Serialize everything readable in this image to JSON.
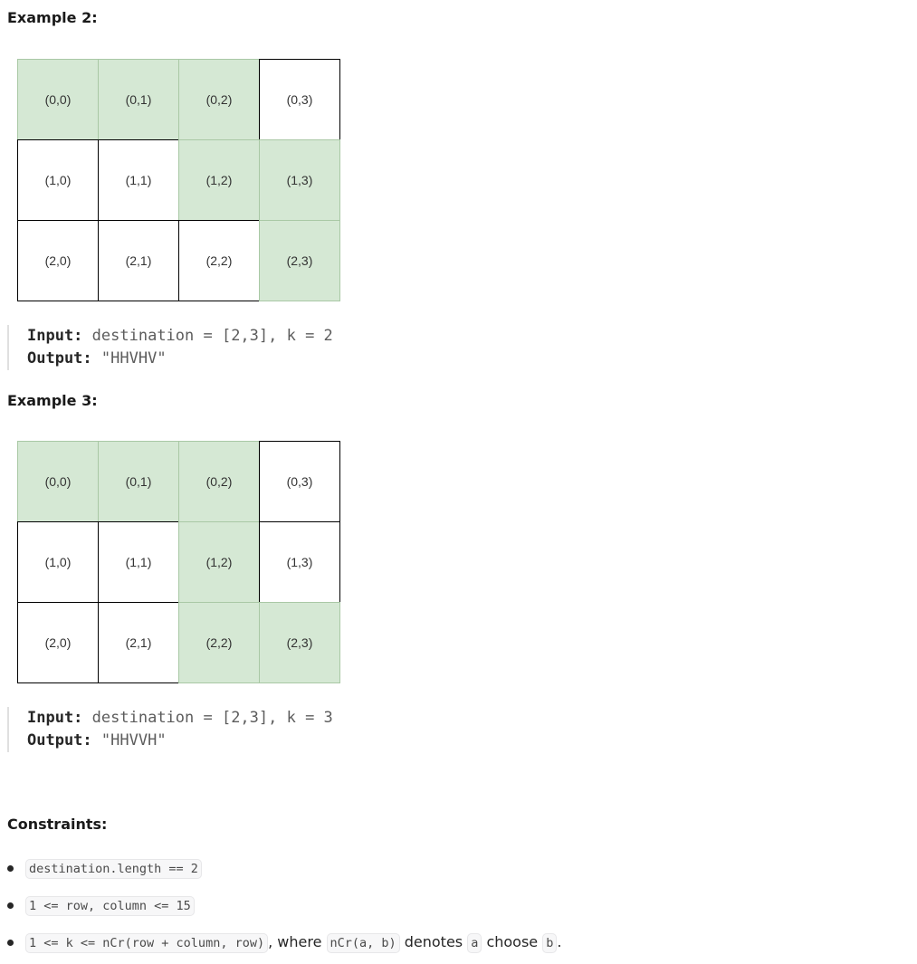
{
  "example2": {
    "heading": "Example 2:",
    "grid": [
      [
        {
          "label": "(0,0)",
          "path": true
        },
        {
          "label": "(0,1)",
          "path": true
        },
        {
          "label": "(0,2)",
          "path": true
        },
        {
          "label": "(0,3)",
          "path": false
        }
      ],
      [
        {
          "label": "(1,0)",
          "path": false
        },
        {
          "label": "(1,1)",
          "path": false
        },
        {
          "label": "(1,2)",
          "path": true
        },
        {
          "label": "(1,3)",
          "path": true
        }
      ],
      [
        {
          "label": "(2,0)",
          "path": false
        },
        {
          "label": "(2,1)",
          "path": false
        },
        {
          "label": "(2,2)",
          "path": false
        },
        {
          "label": "(2,3)",
          "path": true
        }
      ]
    ],
    "input_label": "Input:",
    "input_value": "destination = [2,3], k = 2",
    "output_label": "Output:",
    "output_value": "\"HHVHV\""
  },
  "example3": {
    "heading": "Example 3:",
    "grid": [
      [
        {
          "label": "(0,0)",
          "path": true
        },
        {
          "label": "(0,1)",
          "path": true
        },
        {
          "label": "(0,2)",
          "path": true
        },
        {
          "label": "(0,3)",
          "path": false
        }
      ],
      [
        {
          "label": "(1,0)",
          "path": false
        },
        {
          "label": "(1,1)",
          "path": false
        },
        {
          "label": "(1,2)",
          "path": true
        },
        {
          "label": "(1,3)",
          "path": false
        }
      ],
      [
        {
          "label": "(2,0)",
          "path": false
        },
        {
          "label": "(2,1)",
          "path": false
        },
        {
          "label": "(2,2)",
          "path": true
        },
        {
          "label": "(2,3)",
          "path": true
        }
      ]
    ],
    "input_label": "Input:",
    "input_value": "destination = [2,3], k = 3",
    "output_label": "Output:",
    "output_value": "\"HHVVH\""
  },
  "constraints": {
    "heading": "Constraints:",
    "items": [
      {
        "code": "destination.length == 2"
      },
      {
        "code": "1 <= row, column <= 15"
      },
      {
        "code": "1 <= k <= nCr(row + column, row)",
        "text1": ", where ",
        "code2": "nCr(a, b)",
        "text2": " denotes ",
        "code3": "a",
        "text3": " choose ",
        "code4": "b",
        "text4": "."
      }
    ]
  },
  "colors": {
    "path_cell": "#d5e8d4",
    "path_border": "#a9c8a5",
    "plain_cell": "#ffffff",
    "plain_border": "#000000"
  }
}
